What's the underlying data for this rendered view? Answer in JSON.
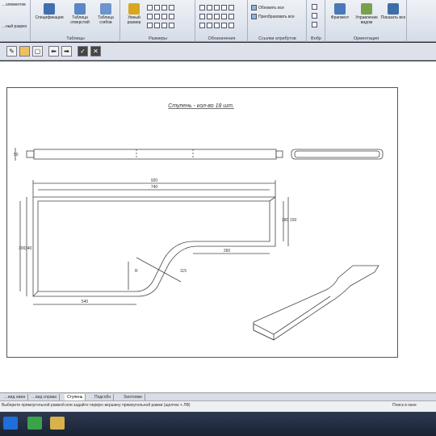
{
  "ribbon": {
    "partial_top_label": "…элементов",
    "left_button_label": "…ный разрез",
    "groups": [
      {
        "label": "Таблицы",
        "buttons": [
          "Спецификация",
          "Таблица отверстий",
          "Таблица сгибов"
        ]
      },
      {
        "label": "Размеры",
        "buttons": [
          "Умный размер"
        ]
      },
      {
        "label": "Обозначения"
      },
      {
        "label": "Ссылки атрибутов",
        "buttons": [
          "Обновить все",
          "Преобразовать все"
        ]
      },
      {
        "label": "Вобр"
      },
      {
        "label": "Ориентация",
        "buttons": [
          "Фрагмент",
          "Управление видом",
          "Показать все"
        ]
      }
    ]
  },
  "toolbar": {
    "icons": [
      "sketch-icon",
      "highlight-icon",
      "square-icon",
      "arrow-left-icon",
      "arrow-right-icon",
      "check-icon",
      "close-icon"
    ],
    "check_glyph": "✓",
    "close_glyph": "✕",
    "left_glyph": "⬅",
    "right_glyph": "➡"
  },
  "drawing": {
    "title": "Ступень - кол-во 18 шт.",
    "dims": {
      "overall_width": "920",
      "inner_width": "740",
      "right_height_a": "180",
      "right_height_b": "150",
      "bottom_right": "260",
      "bottom_left": "540",
      "left_height_a": "300",
      "left_height_b": "340",
      "left_top": "50",
      "curve_a": "R",
      "curve_b": "115"
    }
  },
  "tabs": {
    "items": [
      "…вид нижн",
      "…вид справа",
      "Ступень",
      "Подсобн",
      "Заготовки"
    ],
    "active_index": 2
  },
  "status": {
    "message": "Выберите прямоугольной рамкой или задайте первую вершину прямоугольной рамки (щелчок + ЛВ)",
    "right": "Поиск в окне"
  },
  "colors": {
    "ribbon_bg": "#e3e8f0",
    "line": "#444444",
    "taskbar": "#1f2a40"
  }
}
